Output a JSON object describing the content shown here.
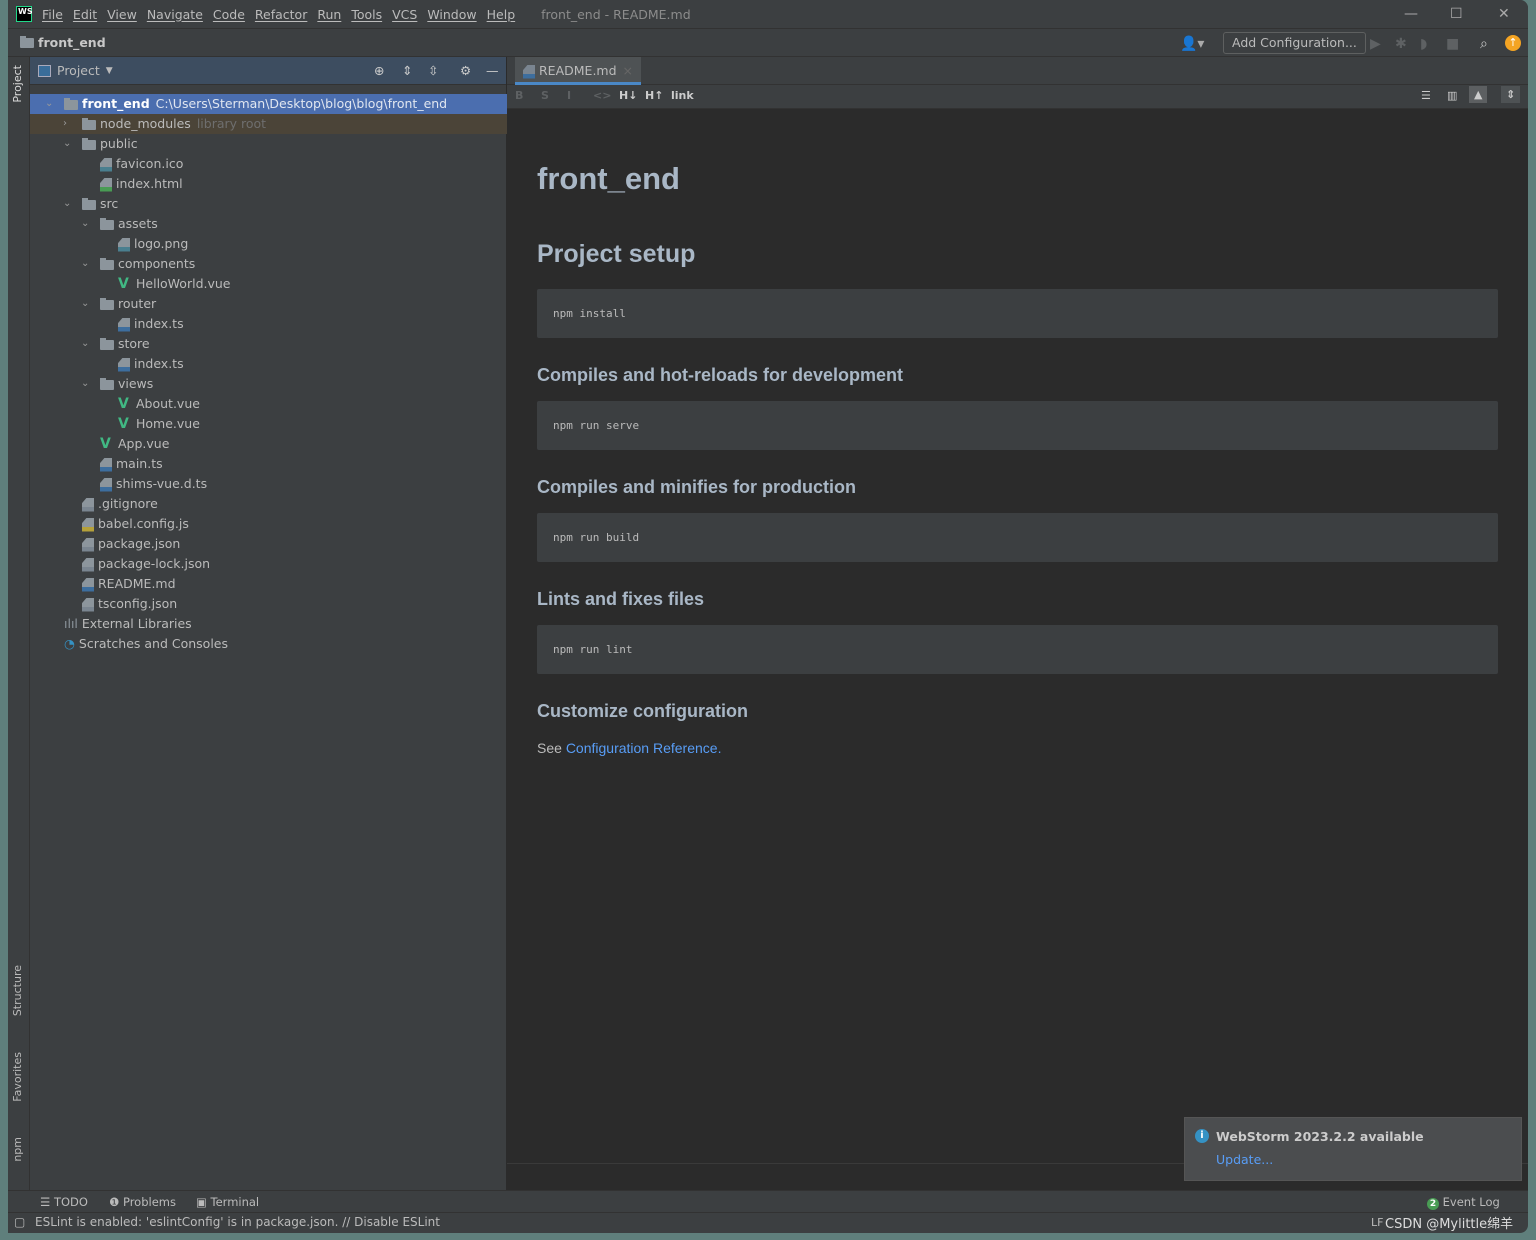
{
  "titlebar": {
    "menu": [
      "File",
      "Edit",
      "View",
      "Navigate",
      "Code",
      "Refactor",
      "Run",
      "Tools",
      "VCS",
      "Window",
      "Help"
    ],
    "title": "front_end - README.md",
    "logo": "WS"
  },
  "navbar": {
    "project": "front_end",
    "add_configuration": "Add Configuration..."
  },
  "side_tabs": {
    "project": "Project",
    "structure": "Structure",
    "favorites": "Favorites",
    "npm": "npm"
  },
  "project_panel": {
    "title": "Project",
    "tree": [
      {
        "label": "front_end",
        "extra": "C:\\Users\\Sterman\\Desktop\\blog\\blog\\front_end",
        "type": "folder",
        "depth": 0,
        "expanded": true,
        "selected": true
      },
      {
        "label": "node_modules",
        "extra": "library root",
        "type": "folder",
        "depth": 1,
        "expanded": false
      },
      {
        "label": "public",
        "type": "folder",
        "depth": 1,
        "expanded": true
      },
      {
        "label": "favicon.ico",
        "type": "image",
        "depth": 2
      },
      {
        "label": "index.html",
        "type": "html",
        "depth": 2
      },
      {
        "label": "src",
        "type": "folder",
        "depth": 1,
        "expanded": true
      },
      {
        "label": "assets",
        "type": "folder",
        "depth": 2,
        "expanded": true
      },
      {
        "label": "logo.png",
        "type": "image",
        "depth": 3
      },
      {
        "label": "components",
        "type": "folder",
        "depth": 2,
        "expanded": true
      },
      {
        "label": "HelloWorld.vue",
        "type": "vue",
        "depth": 3
      },
      {
        "label": "router",
        "type": "folder",
        "depth": 2,
        "expanded": true
      },
      {
        "label": "index.ts",
        "type": "ts",
        "depth": 3
      },
      {
        "label": "store",
        "type": "folder",
        "depth": 2,
        "expanded": true
      },
      {
        "label": "index.ts",
        "type": "ts",
        "depth": 3
      },
      {
        "label": "views",
        "type": "folder",
        "depth": 2,
        "expanded": true
      },
      {
        "label": "About.vue",
        "type": "vue",
        "depth": 3
      },
      {
        "label": "Home.vue",
        "type": "vue",
        "depth": 3
      },
      {
        "label": "App.vue",
        "type": "vue",
        "depth": 2
      },
      {
        "label": "main.ts",
        "type": "ts",
        "depth": 2
      },
      {
        "label": "shims-vue.d.ts",
        "type": "ts",
        "depth": 2
      },
      {
        "label": ".gitignore",
        "type": "config",
        "depth": 1
      },
      {
        "label": "babel.config.js",
        "type": "js",
        "depth": 1
      },
      {
        "label": "package.json",
        "type": "config",
        "depth": 1
      },
      {
        "label": "package-lock.json",
        "type": "config",
        "depth": 1
      },
      {
        "label": "README.md",
        "type": "md",
        "depth": 1
      },
      {
        "label": "tsconfig.json",
        "type": "config",
        "depth": 1
      },
      {
        "label": "External Libraries",
        "type": "libraries",
        "depth": 0
      },
      {
        "label": "Scratches and Consoles",
        "type": "scratches",
        "depth": 0
      }
    ]
  },
  "editor": {
    "tab": "README.md",
    "md_toolbar": [
      "B",
      "S",
      "I",
      "<>",
      "H↓",
      "H↑",
      "link"
    ],
    "preview": {
      "h1": "front_end",
      "h2": "Project setup",
      "code1": "npm install",
      "h3_1": "Compiles and hot-reloads for development",
      "code2": "npm run serve",
      "h3_2": "Compiles and minifies for production",
      "code3": "npm run build",
      "h3_3": "Lints and fixes files",
      "code4": "npm run lint",
      "h3_4": "Customize configuration",
      "see": "See ",
      "link": "Configuration Reference",
      "period": "."
    }
  },
  "notification": {
    "title": "WebStorm 2023.2.2 available",
    "action": "Update..."
  },
  "toolwindows": {
    "todo": "TODO",
    "problems": "Problems",
    "terminal": "Terminal",
    "event_log": "Event Log",
    "event_count": "2"
  },
  "status": {
    "message": "ESLint is enabled: 'eslintConfig' is in package.json. // Disable ESLint",
    "line_sep": "LF",
    "watermark": "CSDN @Mylittle绵羊"
  },
  "colors": {
    "accent": "#4b6eaf",
    "link": "#589df6",
    "update": "#f4a423"
  }
}
